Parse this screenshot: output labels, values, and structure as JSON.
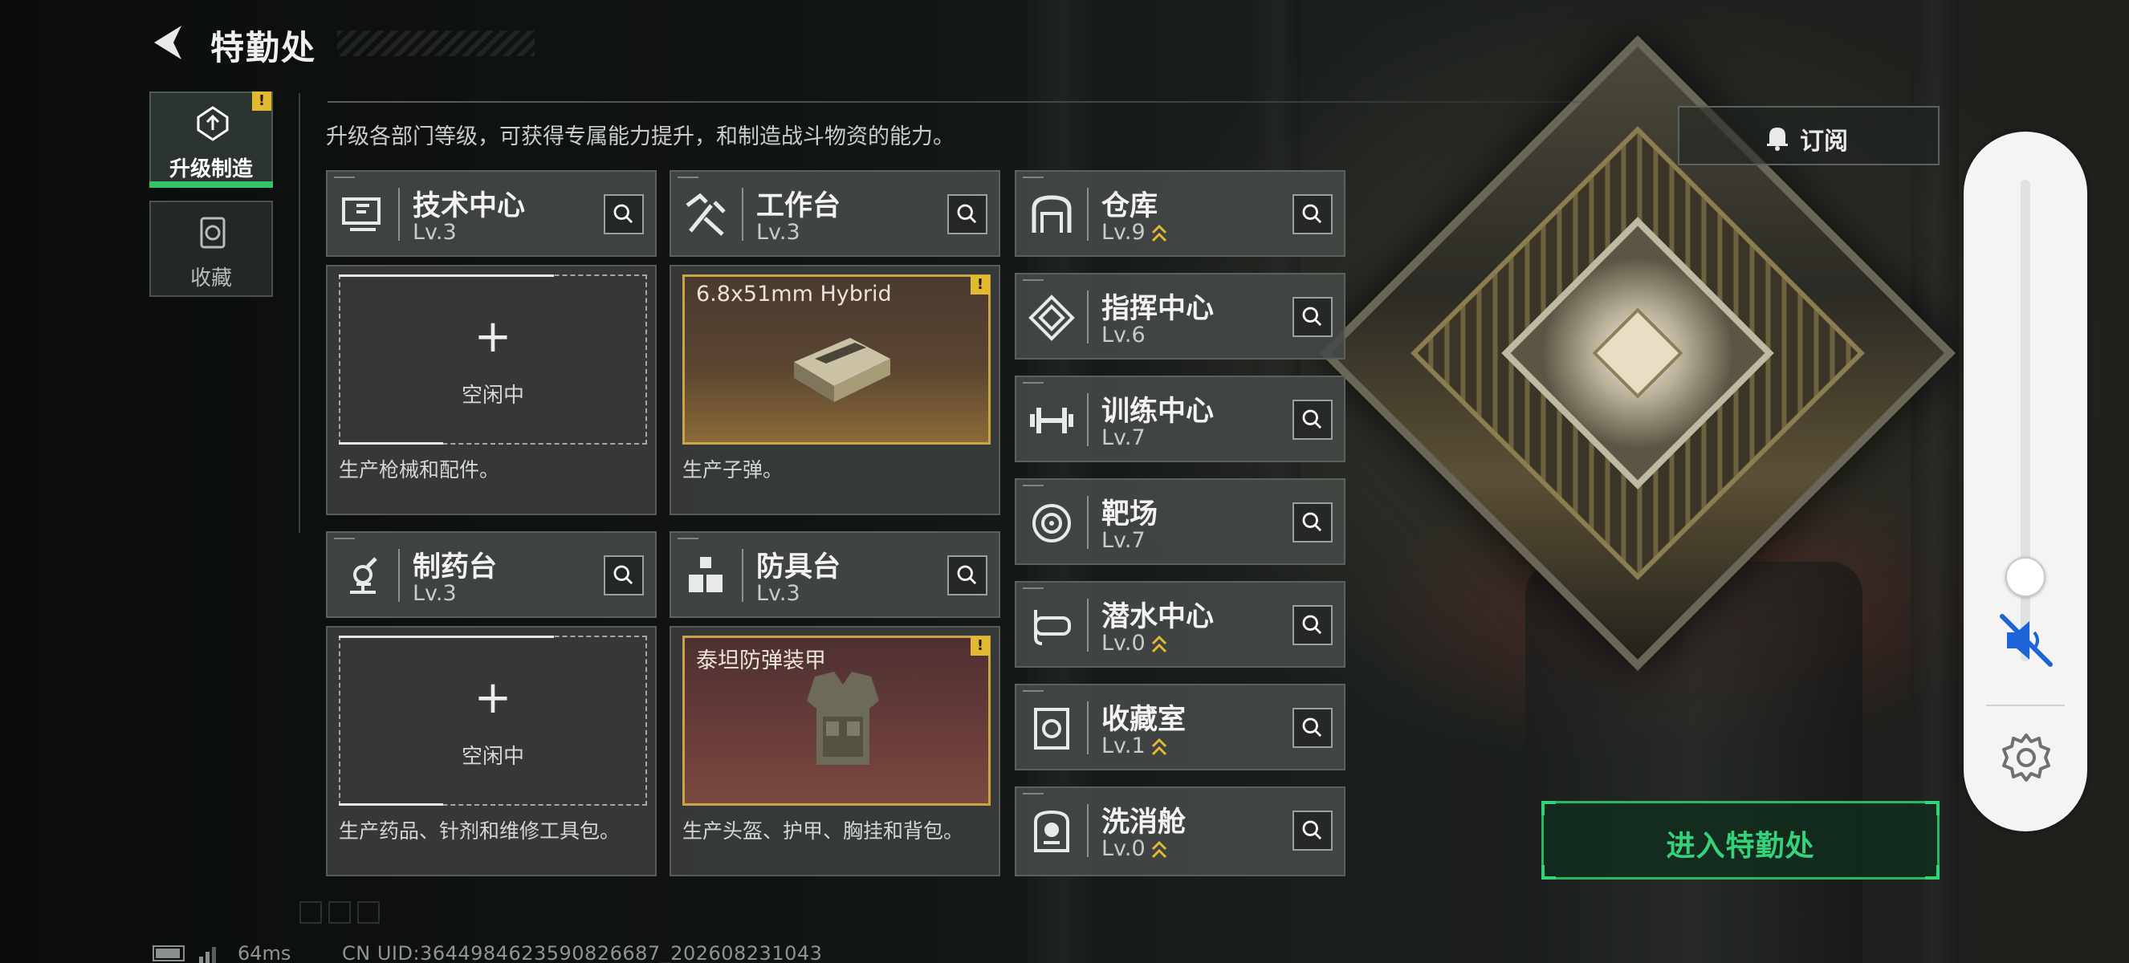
{
  "header": {
    "title": "特勤处",
    "back_icon": "back-arrow-icon"
  },
  "left_tabs": [
    {
      "label": "升级制造",
      "icon": "upgrade-icon",
      "active": true,
      "warning": "!"
    },
    {
      "label": "收藏",
      "icon": "collection-icon",
      "active": false
    }
  ],
  "subtitle": "升级各部门等级，可获得专属能力提升，和制造战斗物资的能力。",
  "subscribe": {
    "label": "订阅",
    "icon": "bell-icon"
  },
  "production": [
    {
      "name": "技术中心",
      "level": "Lv.3",
      "icon": "tech-center-icon",
      "state": "idle",
      "plus": "+",
      "status": "空闲中",
      "desc": "生产枪械和配件。"
    },
    {
      "name": "工作台",
      "level": "Lv.3",
      "icon": "workbench-icon",
      "state": "item",
      "item_name": "6.8x51mm Hybrid",
      "warning": "!",
      "desc": "生产子弹。"
    },
    {
      "name": "制药台",
      "level": "Lv.3",
      "icon": "pharmacy-icon",
      "state": "idle",
      "plus": "+",
      "status": "空闲中",
      "desc": "生产药品、针剂和维修工具包。"
    },
    {
      "name": "防具台",
      "level": "Lv.3",
      "icon": "armor-bench-icon",
      "state": "item",
      "item_name": "泰坦防弹装甲",
      "warning": "!",
      "desc": "生产头盔、护甲、胸挂和背包。"
    }
  ],
  "facilities": [
    {
      "name": "仓库",
      "level": "Lv.9",
      "icon": "warehouse-icon",
      "upgradable": true
    },
    {
      "name": "指挥中心",
      "level": "Lv.6",
      "icon": "command-center-icon",
      "upgradable": false
    },
    {
      "name": "训练中心",
      "level": "Lv.7",
      "icon": "training-center-icon",
      "upgradable": false
    },
    {
      "name": "靶场",
      "level": "Lv.7",
      "icon": "shooting-range-icon",
      "upgradable": false
    },
    {
      "name": "潜水中心",
      "level": "Lv.0",
      "icon": "diving-center-icon",
      "upgradable": true
    },
    {
      "name": "收藏室",
      "level": "Lv.1",
      "icon": "collection-room-icon",
      "upgradable": true
    },
    {
      "name": "洗消舱",
      "level": "Lv.0",
      "icon": "decon-chamber-icon",
      "upgradable": true
    }
  ],
  "enter_button": "进入特勤处",
  "volume": {
    "level": 0.19,
    "muted": true
  },
  "footer": {
    "ping": "64ms",
    "uid": "CN UID:3644984623590826687_202608231043"
  },
  "colors": {
    "accent_green": "#34d27a",
    "warning_yellow": "#e2b92f",
    "item_border": "#c9a547"
  }
}
